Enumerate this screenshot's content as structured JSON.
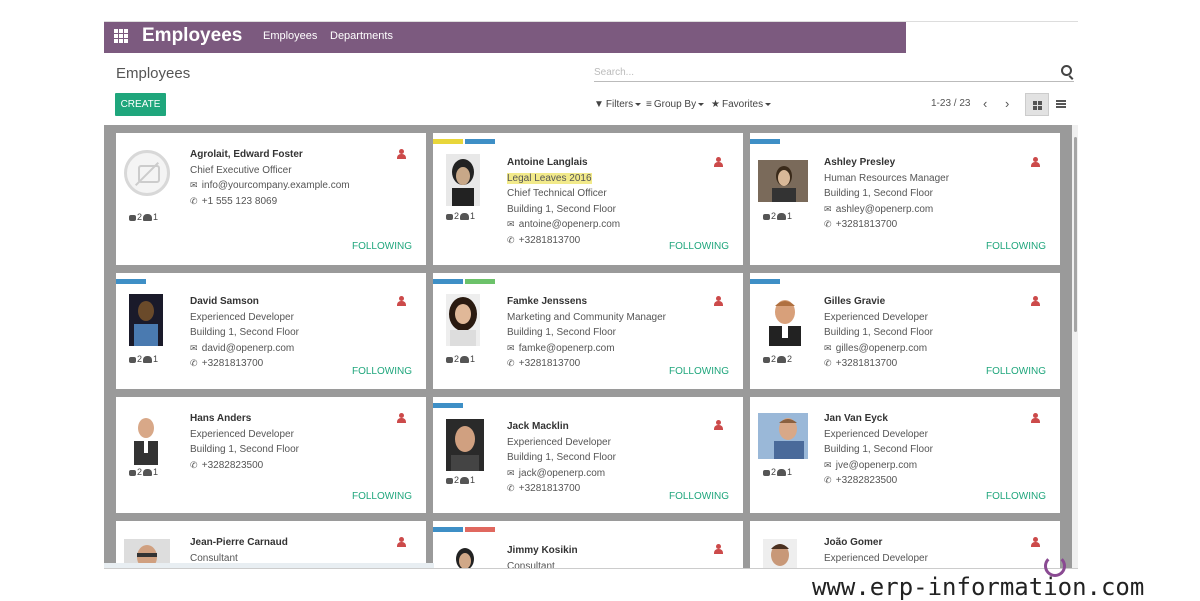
{
  "navbar": {
    "title": "Employees",
    "menu": [
      "Employees",
      "Departments"
    ]
  },
  "control": {
    "breadcrumb": "Employees",
    "search_placeholder": "Search...",
    "create_label": "CREATE",
    "filters_label": "Filters",
    "groupby_label": "Group By",
    "favorites_label": "Favorites",
    "pager": "1-23 / 23"
  },
  "colors": {
    "navbar": "#7c5a7f",
    "primary": "#1fa67c",
    "tag_blue": "#3e8fc6",
    "tag_yellow": "#e8d63a",
    "tag_green": "#6cc26a",
    "tag_red": "#e0685f"
  },
  "cards": [
    {
      "name": "Agrolait, Edward Foster",
      "job": "Chief Executive Officer",
      "location": "",
      "email": "info@yourcompany.example.com",
      "phone": "+1 555 123 8069",
      "messages": "2",
      "followers": "1",
      "following": "FOLLOWING"
    },
    {
      "name": "Antoine Langlais",
      "job": "Legal Leaves 2016",
      "location": "Chief Technical Officer",
      "extra": "Building 1, Second Floor",
      "email": "antoine@openerp.com",
      "phone": "+3281813700",
      "messages": "2",
      "followers": "1",
      "following": "FOLLOWING"
    },
    {
      "name": "Ashley Presley",
      "job": "Human Resources Manager",
      "location": "Building 1, Second Floor",
      "email": "ashley@openerp.com",
      "phone": "+3281813700",
      "messages": "2",
      "followers": "1",
      "following": "FOLLOWING"
    },
    {
      "name": "David Samson",
      "job": "Experienced Developer",
      "location": "Building 1, Second Floor",
      "email": "david@openerp.com",
      "phone": "+3281813700",
      "messages": "2",
      "followers": "1",
      "following": "FOLLOWING"
    },
    {
      "name": "Famke Jenssens",
      "job": "Marketing and Community Manager",
      "location": "Building 1, Second Floor",
      "email": "famke@openerp.com",
      "phone": "+3281813700",
      "messages": "2",
      "followers": "1",
      "following": "FOLLOWING"
    },
    {
      "name": "Gilles Gravie",
      "job": "Experienced Developer",
      "location": "Building 1, Second Floor",
      "email": "gilles@openerp.com",
      "phone": "+3281813700",
      "messages": "2",
      "followers": "2",
      "following": "FOLLOWING"
    },
    {
      "name": "Hans Anders",
      "job": "Experienced Developer",
      "location": "Building 1, Second Floor",
      "email": "",
      "phone": "+3282823500",
      "messages": "2",
      "followers": "1",
      "following": "FOLLOWING"
    },
    {
      "name": "Jack Macklin",
      "job": "Experienced Developer",
      "location": "Building 1, Second Floor",
      "email": "jack@openerp.com",
      "phone": "+3281813700",
      "messages": "2",
      "followers": "1",
      "following": "FOLLOWING"
    },
    {
      "name": "Jan Van Eyck",
      "job": "Experienced Developer",
      "location": "Building 1, Second Floor",
      "email": "jve@openerp.com",
      "phone": "+3282823500",
      "messages": "2",
      "followers": "1",
      "following": "FOLLOWING"
    },
    {
      "name": "Jean-Pierre Carnaud",
      "job": "Consultant"
    },
    {
      "name": "Jimmy Kosikin",
      "job": "Consultant"
    },
    {
      "name": "João Gomer",
      "job": "Experienced Developer"
    }
  ],
  "watermark": "www.erp-information.com"
}
